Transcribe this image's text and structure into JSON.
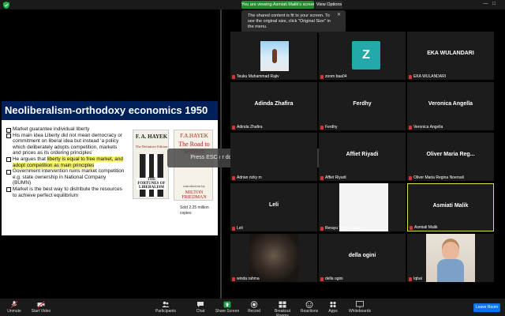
{
  "topbar": {
    "viewing_text": "You are viewing Asmiati Malik's screen",
    "view_options_label": "View Options"
  },
  "fit_tooltip": {
    "text": "The shared content is fit to your screen. To see the original size, click \"Original Size\" in the menu."
  },
  "slide": {
    "title": "Neoliberalism-orthodoxy economics 1950",
    "bullets": [
      {
        "pre": "Market guarantee individual liberty",
        "hl": "",
        "post": ""
      },
      {
        "pre": "His main idea Liberty did not mean democracy or commitment on liberal idea but instead ‘a policy which deliberately adopts competition, markets and prices as its ordering principles’",
        "hl": "",
        "post": ""
      },
      {
        "pre": "He argues that ",
        "hl": "liberty is equal to free market, and adopt competition as main principles",
        "post": ""
      },
      {
        "pre": "Government intervention ruins market competition e.g. state ownership in National Company (BUMN)",
        "hl": "",
        "post": ""
      },
      {
        "pre": "Market is the best way to distribute the resources to achieve perfect equilibrium",
        "hl": "",
        "post": ""
      }
    ],
    "book1": {
      "author": "F. A. HAYEK",
      "subtitle": "The Definitive Edition",
      "title": "THE FORTUNES OF LIBERALISM"
    },
    "book2": {
      "author": "F.A.HAYEK",
      "title": "The Road to Serfdom",
      "byline": "introduction by",
      "intro_name": "MILTON FRIEDMAN"
    },
    "sold_note": "Sold 2.25 million copies"
  },
  "fullscreen_hint": "Press ESC or double-click to exit full screen mode",
  "gallery": {
    "tiles": [
      {
        "name": "",
        "caption": "Teuku Muhammad Rajiv"
      },
      {
        "name": "",
        "caption": "zoom baa04",
        "avatar_letter": "Z"
      },
      {
        "name": "EKA WULANDARI",
        "caption": "EKA WULANDARI"
      },
      {
        "name": "Adinda Zhafira",
        "caption": "Adinda Zhafira"
      },
      {
        "name": "Ferdhy",
        "caption": "Ferdhy"
      },
      {
        "name": "Veronica Angella",
        "caption": "Veronica Angella"
      },
      {
        "name": "",
        "caption": "Adrian rizky m"
      },
      {
        "name": "Affiet Riyadi",
        "caption": "Affiet Riyadi"
      },
      {
        "name": "Oliver Maria Reg...",
        "caption": "Oliver Maria Regina Noersali"
      },
      {
        "name": "Leli",
        "caption": "Leli"
      },
      {
        "name": "",
        "caption": "Rerayu Tasyai Nastiti"
      },
      {
        "name": "Asmiati Malik",
        "caption": "Asmiati Malik"
      },
      {
        "name": "",
        "caption": "winda rahma"
      },
      {
        "name": "della ogini",
        "caption": "della ogini"
      },
      {
        "name": "",
        "caption": "Iqbal"
      }
    ]
  },
  "toolbar": {
    "unmute": "Unmute",
    "start_video": "Start Video",
    "participants": "Participants",
    "participants_count": "15",
    "chat": "Chat",
    "share_screen": "Share Screen",
    "record": "Record",
    "breakout": "Breakout Rooms",
    "reactions": "Reactions",
    "apps": "Apps",
    "whiteboards": "Whiteboards",
    "leave": "Leave Room"
  },
  "colors": {
    "accent_green": "#1f8d2f",
    "slide_title_bg": "#00205b",
    "highlight": "#f4f06a",
    "active_speaker_border": "#d8e14c",
    "leave_blue": "#0e72ed",
    "muted_red": "#e0323a"
  }
}
